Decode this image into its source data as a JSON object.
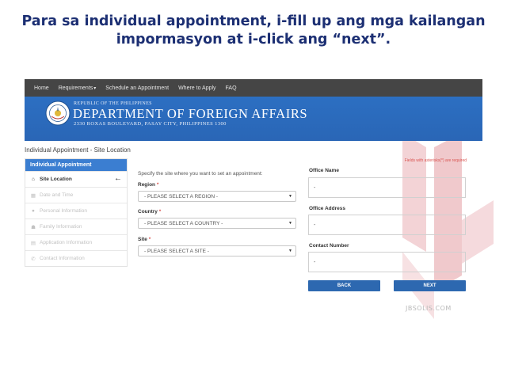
{
  "caption": {
    "line1": "Para sa individual appointment, i-fill up ang mga kailangan",
    "line2": "impormasyon at i-click ang “next”."
  },
  "nav": {
    "items": [
      {
        "label": "Home"
      },
      {
        "label": "Requirements",
        "has_dropdown": true
      },
      {
        "label": "Schedule an Appointment"
      },
      {
        "label": "Where to Apply"
      },
      {
        "label": "FAQ"
      }
    ]
  },
  "banner": {
    "republic": "REPUBLIC OF THE PHILIPPINES",
    "department": "DEPARTMENT OF FOREIGN AFFAIRS",
    "address": "2330 ROXAS BOULEVARD, PASAY CITY, PHILIPPINES 1300",
    "seal_icon": "dfa-seal-icon"
  },
  "page_title": "Individual Appointment - Site Location",
  "sidebar": {
    "header": "Individual Appointment",
    "items": [
      {
        "label": "Site Location",
        "icon": "home-icon",
        "active": true
      },
      {
        "label": "Date and Time",
        "icon": "calendar-icon",
        "active": false
      },
      {
        "label": "Personal Information",
        "icon": "user-icon",
        "active": false
      },
      {
        "label": "Family Information",
        "icon": "users-icon",
        "active": false
      },
      {
        "label": "Application Information",
        "icon": "card-icon",
        "active": false
      },
      {
        "label": "Contact Information",
        "icon": "phone-icon",
        "active": false
      }
    ]
  },
  "form": {
    "instruction": "Specify the site where you want to set an appointment:",
    "region": {
      "label": "Region",
      "value": "- PLEASE SELECT A REGION -"
    },
    "country": {
      "label": "Country",
      "value": "- PLEASE SELECT A COUNTRY -"
    },
    "site": {
      "label": "Site",
      "value": "- PLEASE SELECT A SITE -"
    },
    "required_mark": "*"
  },
  "office": {
    "required_note": "Fields with asterisks(*) are required",
    "name": {
      "label": "Office Name",
      "value": "-"
    },
    "address": {
      "label": "Office Address",
      "value": "-"
    },
    "contact": {
      "label": "Contact Number",
      "value": "-"
    }
  },
  "buttons": {
    "back": "BACK",
    "next": "NEXT"
  },
  "watermark": {
    "text": "JBSOLIS.COM"
  },
  "colors": {
    "caption": "#1c2f73",
    "banner": "#2c6fc2",
    "button": "#2d68b0",
    "required": "#d9534f"
  }
}
